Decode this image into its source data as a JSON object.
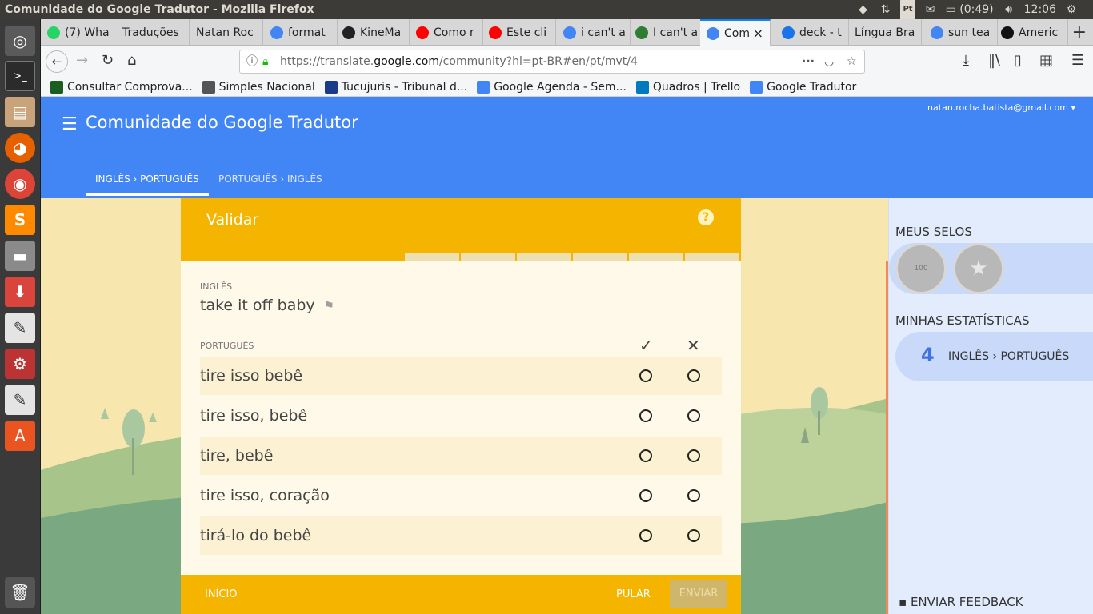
{
  "window": {
    "title": "Comunidade do Google Tradutor - Mozilla Firefox"
  },
  "tray": {
    "keyboard": "Pt",
    "battery": "(0:49)",
    "clock": "12:06"
  },
  "tabs": [
    {
      "label": "(7) Wha",
      "fav": "whatsapp",
      "color": "#25d366"
    },
    {
      "label": "Traduções",
      "fav": "none",
      "color": "#d7d7d7"
    },
    {
      "label": "Natan Roc",
      "fav": "none",
      "color": "#d7d7d7"
    },
    {
      "label": "format",
      "fav": "google",
      "color": "#4285f4"
    },
    {
      "label": "KineMa",
      "fav": "kinemaster",
      "color": "#222222"
    },
    {
      "label": "Como r",
      "fav": "youtube",
      "color": "#ff0000"
    },
    {
      "label": "Este cli",
      "fav": "youtube",
      "color": "#ff0000"
    },
    {
      "label": "i can't a",
      "fav": "google",
      "color": "#4285f4"
    },
    {
      "label": "I can't a",
      "fav": "green",
      "color": "#2e7d32"
    },
    {
      "label": "Com",
      "fav": "translate",
      "color": "#4285f4",
      "active": true
    },
    {
      "label": "deck - t",
      "fav": "chat",
      "color": "#1a73e8"
    },
    {
      "label": "Língua Bra",
      "fav": "none",
      "color": "#d7d7d7"
    },
    {
      "label": "sun tea",
      "fav": "google",
      "color": "#4285f4"
    },
    {
      "label": "Americ",
      "fav": "wikipedia",
      "color": "#111111"
    }
  ],
  "nav": {
    "url_prefix": "https://translate.",
    "url_domain": "google.com",
    "url_suffix": "/community?hl=pt-BR#en/pt/mvt/4"
  },
  "bookmarks": [
    {
      "label": "Consultar Comprova...",
      "color": "#1b5e20"
    },
    {
      "label": "Simples Nacional",
      "color": "#555555"
    },
    {
      "label": "Tucujuris - Tribunal d...",
      "color": "#1a3a8a"
    },
    {
      "label": "Google Agenda - Sem...",
      "color": "#4285f4"
    },
    {
      "label": "Quadros | Trello",
      "color": "#0079bf"
    },
    {
      "label": "Google Tradutor",
      "color": "#4285f4"
    }
  ],
  "header": {
    "title": "Comunidade do Google Tradutor",
    "email": "natan.rocha.batista@gmail.com",
    "tab_en_pt": "INGLÊS › PORTUGUÊS",
    "tab_pt_en": "PORTUGUÊS › INGLÊS"
  },
  "card": {
    "heading": "Validar",
    "help": "?",
    "progress": {
      "done": 4,
      "total": 10
    },
    "source_label": "INGLÊS",
    "source_text": "take it off baby",
    "target_label": "PORTUGUÊS",
    "check": "✓",
    "cross": "✕",
    "rows": [
      "tire isso bebê",
      "tire isso, bebê",
      "tire, bebê",
      "tire isso, coração",
      "tirá-lo do bebê"
    ],
    "footer": {
      "start": "INÍCIO",
      "skip": "PULAR",
      "send": "ENVIAR"
    }
  },
  "sidebar": {
    "badges_title": "MEUS SELOS",
    "stats_title": "MINHAS ESTATÍSTICAS",
    "stat_value": "4",
    "stat_label": "INGLÊS › PORTUGUÊS",
    "feedback": "ENVIAR FEEDBACK",
    "trophy_text": "100"
  },
  "colors": {
    "accent_blue": "#4285f4",
    "accent_yellow": "#f4b400"
  }
}
